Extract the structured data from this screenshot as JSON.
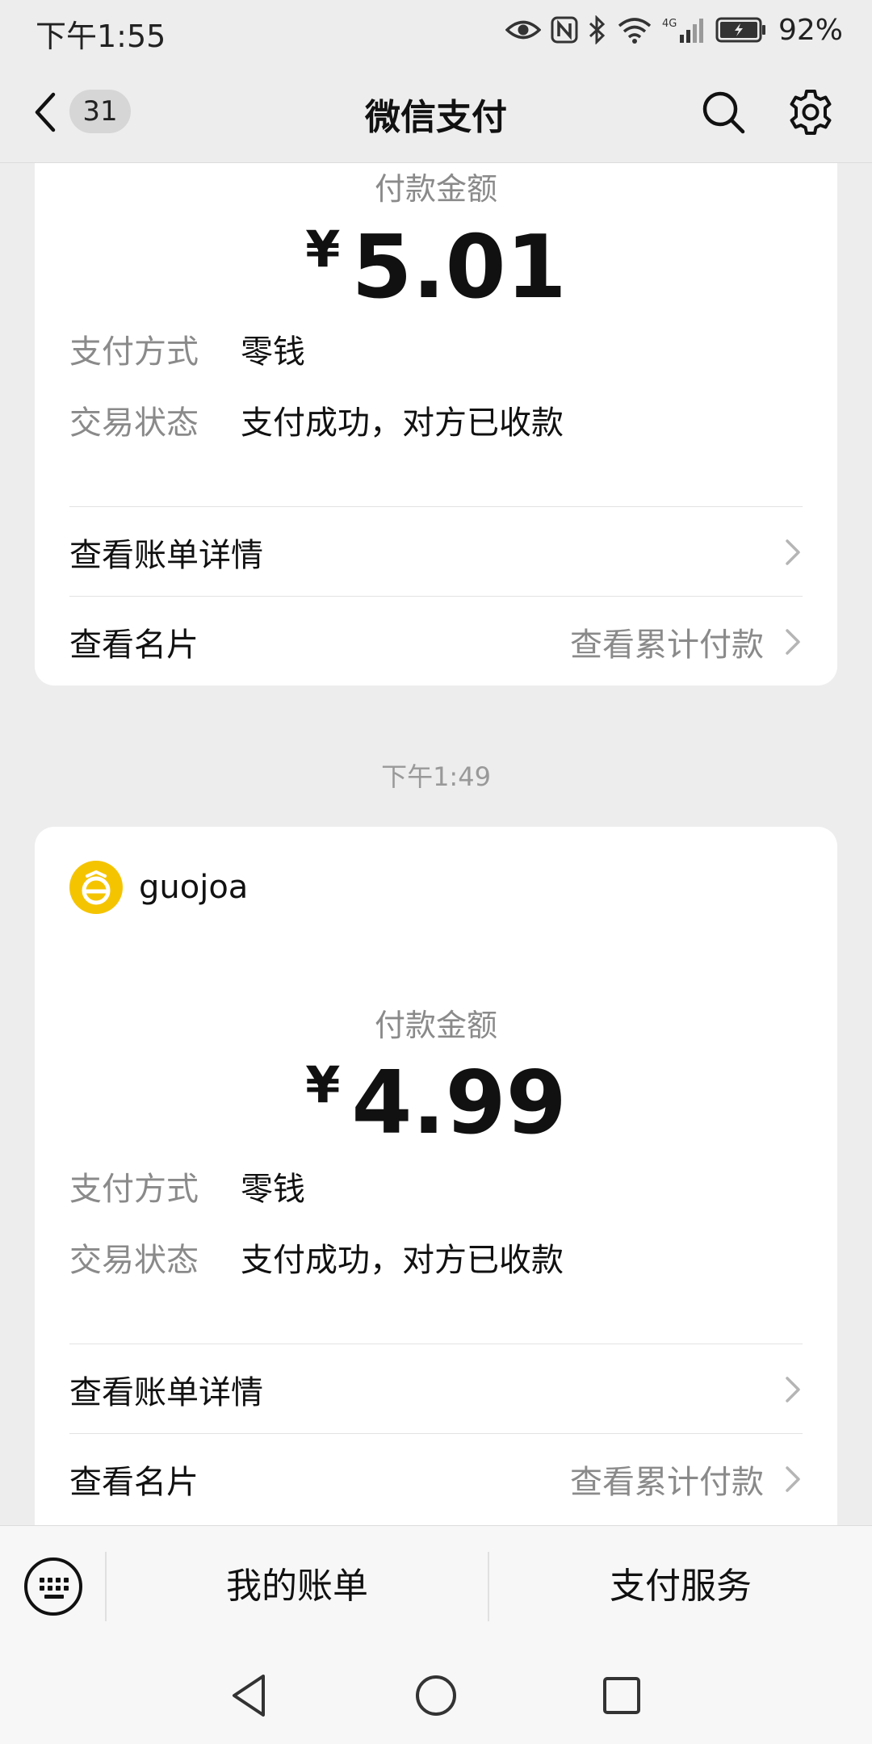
{
  "status_bar": {
    "time": "下午1:55",
    "battery": "92%",
    "network": "4G",
    "icons": [
      "eye-icon",
      "nfc-icon",
      "bluetooth-icon",
      "wifi-icon",
      "signal-icon",
      "battery-icon"
    ]
  },
  "header": {
    "back_icon": "chevron-left-icon",
    "unread_count": "31",
    "title": "微信支付",
    "search_icon": "search-icon",
    "settings_icon": "gear-icon"
  },
  "messages": [
    {
      "amount_label": "付款金额",
      "currency": "¥",
      "amount": "5.01",
      "fields": [
        {
          "key": "支付方式",
          "value": "零钱"
        },
        {
          "key": "交易状态",
          "value": "支付成功，对方已收款"
        }
      ],
      "links": [
        {
          "label": "查看账单详情",
          "extra": ""
        },
        {
          "label": "查看名片",
          "extra": "查看累计付款"
        }
      ]
    },
    {
      "timestamp": "下午1:49",
      "merchant": "guojoa",
      "amount_label": "付款金额",
      "currency": "¥",
      "amount": "4.99",
      "fields": [
        {
          "key": "支付方式",
          "value": "零钱"
        },
        {
          "key": "交易状态",
          "value": "支付成功，对方已收款"
        }
      ],
      "links": [
        {
          "label": "查看账单详情",
          "extra": ""
        },
        {
          "label": "查看名片",
          "extra": "查看累计付款"
        }
      ]
    }
  ],
  "bottom_menu": {
    "keyboard_icon": "keyboard-icon",
    "items": [
      {
        "label": "我的账单"
      },
      {
        "label": "支付服务"
      }
    ]
  },
  "system_nav": [
    "back-triangle-icon",
    "home-circle-icon",
    "recents-square-icon"
  ],
  "colors": {
    "background": "#ededed",
    "card": "#ffffff",
    "secondary_text": "#8a8a8a",
    "avatar_yellow": "#f5c400"
  }
}
